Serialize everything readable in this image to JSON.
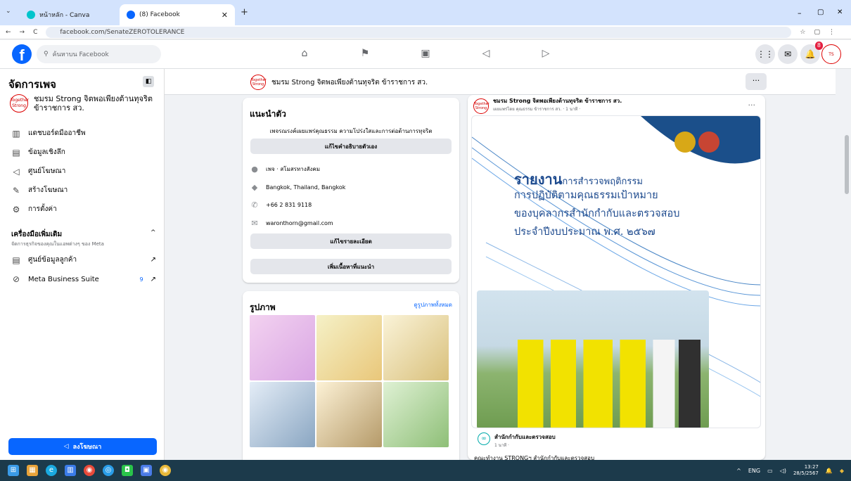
{
  "browser": {
    "tabs": [
      {
        "title": "หน้าหลัก - Canva",
        "active": false
      },
      {
        "title": "(8) Facebook",
        "active": true
      }
    ],
    "new_tab": "+",
    "url": "facebook.com/SenateZEROTOLERANCE",
    "window_controls": [
      "–",
      "▢",
      "✕"
    ]
  },
  "fb": {
    "search_placeholder": "ค้นหาบน Facebook",
    "notification_badge": "8"
  },
  "sidebar": {
    "title": "จัดการเพจ",
    "page_name": "ชมรม Strong จิตพอเพียงต้านทุจริต ข้าราชการ สว.",
    "avatar_text": "Together Strong",
    "items": [
      {
        "label": "แดชบอร์ดมืออาชีพ",
        "icon": "dashboard-icon"
      },
      {
        "label": "ข้อมูลเชิงลึก",
        "icon": "insights-icon"
      },
      {
        "label": "ศูนย์โฆษณา",
        "icon": "megaphone-icon"
      },
      {
        "label": "สร้างโฆษณา",
        "icon": "edit-icon"
      },
      {
        "label": "การตั้งค่า",
        "icon": "gear-icon"
      }
    ],
    "more_tools_title": "เครื่องมือเพิ่มเติม",
    "more_tools_desc": "จัดการธุรกิจของคุณในแอพต่างๆ ของ Meta",
    "tools": [
      {
        "label": "ศูนย์ข้อมูลลูกค้า",
        "icon": "customer-data-icon"
      },
      {
        "label": "Meta Business Suite",
        "icon": "meta-business-icon",
        "count": "9"
      }
    ],
    "advertise_label": "ลงโฆษณา"
  },
  "page_bar": {
    "name": "ชมรม Strong จิตพอเพียงต้านทุจริต ข้าราชการ สว.",
    "more": "···"
  },
  "intro": {
    "title": "แนะนำตัว",
    "bio": "เพจรณรงค์เผยแพร่คุณธรรม ความโปร่งใสและการต่อต้านการทุจริต",
    "edit_bio": "แก้ไขคำอธิบายตัวเอง",
    "details": [
      {
        "icon": "info-icon",
        "text": "เพจ · สโมสรทางสังคม"
      },
      {
        "icon": "location-icon",
        "text": "Bangkok, Thailand, Bangkok"
      },
      {
        "icon": "phone-icon",
        "text": "+66 2 831 9118"
      },
      {
        "icon": "email-icon",
        "text": "waronthorn@gmail.com"
      }
    ],
    "edit_details": "แก้ไขรายละเอียด",
    "add_featured": "เพิ่มเนื้อหาที่แนะนำ"
  },
  "photos": {
    "title": "รูปภาพ",
    "see_all": "ดูรูปภาพทั้งหมด"
  },
  "post": {
    "author": "ชมรม Strong จิตพอเพียงต้านทุจริต ข้าราชการ สว.",
    "meta": "เผยแพร่โดย คุณธรรม ข้าราชการ สว. · 1 นาที ·",
    "more": "···",
    "image_title_big": "รายงาน",
    "image_title_rest": "การสำรวจพฤติกรรม",
    "image_lines": [
      "การปฏิบัติตามคุณธรรมเป้าหมาย",
      "ของบุคลากรสำนักกำกับและตรวจสอบ",
      "ประจำปีงบประมาณ พ.ศ. ๒๕๖๗"
    ],
    "shared_author": "สำนักกำกับและตรวจสอบ",
    "shared_meta": "1 นาที ·",
    "shared_text": "คณะทำงาน STRONGฯ สำนักกำกับและตรวจสอบ"
  },
  "taskbar": {
    "lang": "ENG",
    "time": "13:27",
    "date": "28/5/2567"
  }
}
